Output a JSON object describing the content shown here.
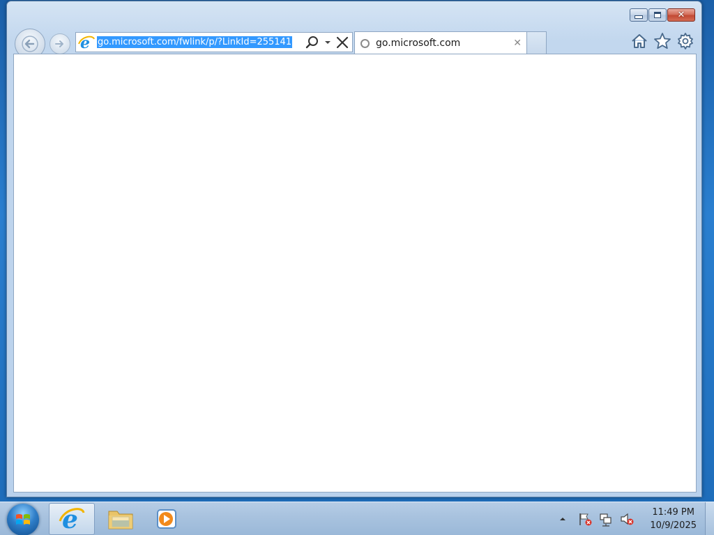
{
  "window": {
    "caption": {
      "minimize_icon": "minimize-icon",
      "maximize_icon": "maximize-icon",
      "close_glyph": "✕"
    }
  },
  "navigation": {
    "back_icon": "back-arrow-icon",
    "forward_icon": "forward-arrow-icon"
  },
  "address_bar": {
    "url": "go.microsoft.com/fwlink/p/?LinkId=255141",
    "search_icon": "search-icon",
    "dropdown_icon": "dropdown-icon",
    "stop_icon": "stop-icon"
  },
  "tab": {
    "title": "go.microsoft.com",
    "close_glyph": "✕"
  },
  "toolbar": {
    "home_icon": "home-icon",
    "favorites_icon": "star-icon",
    "tools_icon": "gear-icon"
  },
  "taskbar": {
    "pinned": [
      "internet-explorer-icon",
      "file-explorer-icon",
      "media-player-icon"
    ],
    "clock": {
      "time": "11:49 PM",
      "date": "10/9/2025"
    }
  },
  "colors": {
    "selection": "#3399ff",
    "close_button": "#c24a34",
    "window_frame": "#c2d7ee",
    "taskbar": "#a9c3df"
  }
}
